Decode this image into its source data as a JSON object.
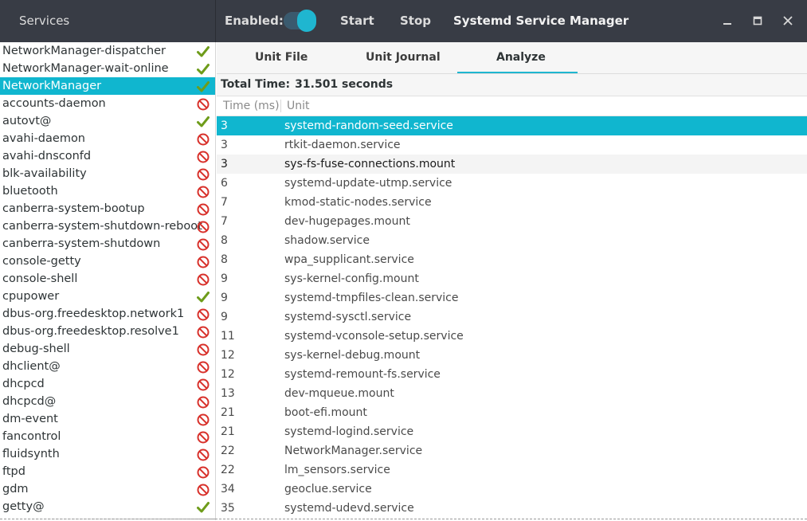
{
  "header": {
    "services_title": "Services",
    "enabled_label": "Enabled:",
    "start_label": "Start",
    "stop_label": "Stop",
    "app_title": "Systemd Service Manager",
    "minimize_icon": "minimize-icon",
    "maximize_icon": "maximize-icon",
    "close_icon": "close-icon",
    "toggle_on": true,
    "accent_color": "#10b6cf"
  },
  "sidebar": {
    "items": [
      {
        "label": "NetworkManager-dispatcher",
        "status": "enabled"
      },
      {
        "label": "NetworkManager-wait-online",
        "status": "enabled"
      },
      {
        "label": "NetworkManager",
        "status": "enabled",
        "selected": true
      },
      {
        "label": "accounts-daemon",
        "status": "disabled"
      },
      {
        "label": "autovt@",
        "status": "enabled"
      },
      {
        "label": "avahi-daemon",
        "status": "disabled"
      },
      {
        "label": "avahi-dnsconfd",
        "status": "disabled"
      },
      {
        "label": "blk-availability",
        "status": "disabled"
      },
      {
        "label": "bluetooth",
        "status": "disabled"
      },
      {
        "label": "canberra-system-bootup",
        "status": "disabled"
      },
      {
        "label": "canberra-system-shutdown-reboot",
        "status": "disabled"
      },
      {
        "label": "canberra-system-shutdown",
        "status": "disabled"
      },
      {
        "label": "console-getty",
        "status": "disabled"
      },
      {
        "label": "console-shell",
        "status": "disabled"
      },
      {
        "label": "cpupower",
        "status": "enabled"
      },
      {
        "label": "dbus-org.freedesktop.network1",
        "status": "disabled"
      },
      {
        "label": "dbus-org.freedesktop.resolve1",
        "status": "disabled"
      },
      {
        "label": "debug-shell",
        "status": "disabled"
      },
      {
        "label": "dhclient@",
        "status": "disabled"
      },
      {
        "label": "dhcpcd",
        "status": "disabled"
      },
      {
        "label": "dhcpcd@",
        "status": "disabled"
      },
      {
        "label": "dm-event",
        "status": "disabled"
      },
      {
        "label": "fancontrol",
        "status": "disabled"
      },
      {
        "label": "fluidsynth",
        "status": "disabled"
      },
      {
        "label": "ftpd",
        "status": "disabled"
      },
      {
        "label": "gdm",
        "status": "disabled"
      },
      {
        "label": "getty@",
        "status": "enabled"
      }
    ]
  },
  "tabs": [
    {
      "label": "Unit File"
    },
    {
      "label": "Unit Journal"
    },
    {
      "label": "Analyze",
      "active": true
    }
  ],
  "analyze": {
    "total_label": "Total Time:",
    "total_value": "31.501 seconds",
    "col_time": "Time (ms)",
    "col_unit": "Unit",
    "rows": [
      {
        "time": "3",
        "unit": "systemd-random-seed.service",
        "state": "selected"
      },
      {
        "time": "3",
        "unit": "rtkit-daemon.service"
      },
      {
        "time": "3",
        "unit": "sys-fs-fuse-connections.mount",
        "state": "hover"
      },
      {
        "time": "6",
        "unit": "systemd-update-utmp.service"
      },
      {
        "time": "7",
        "unit": "kmod-static-nodes.service"
      },
      {
        "time": "7",
        "unit": "dev-hugepages.mount"
      },
      {
        "time": "8",
        "unit": "shadow.service"
      },
      {
        "time": "8",
        "unit": "wpa_supplicant.service"
      },
      {
        "time": "9",
        "unit": "sys-kernel-config.mount"
      },
      {
        "time": "9",
        "unit": "systemd-tmpfiles-clean.service"
      },
      {
        "time": "9",
        "unit": "systemd-sysctl.service"
      },
      {
        "time": "11",
        "unit": "systemd-vconsole-setup.service"
      },
      {
        "time": "12",
        "unit": "sys-kernel-debug.mount"
      },
      {
        "time": "12",
        "unit": "systemd-remount-fs.service"
      },
      {
        "time": "13",
        "unit": "dev-mqueue.mount"
      },
      {
        "time": "21",
        "unit": "boot-efi.mount"
      },
      {
        "time": "21",
        "unit": "systemd-logind.service"
      },
      {
        "time": "22",
        "unit": "NetworkManager.service"
      },
      {
        "time": "22",
        "unit": "lm_sensors.service"
      },
      {
        "time": "34",
        "unit": "geoclue.service"
      },
      {
        "time": "35",
        "unit": "systemd-udevd.service"
      }
    ]
  }
}
